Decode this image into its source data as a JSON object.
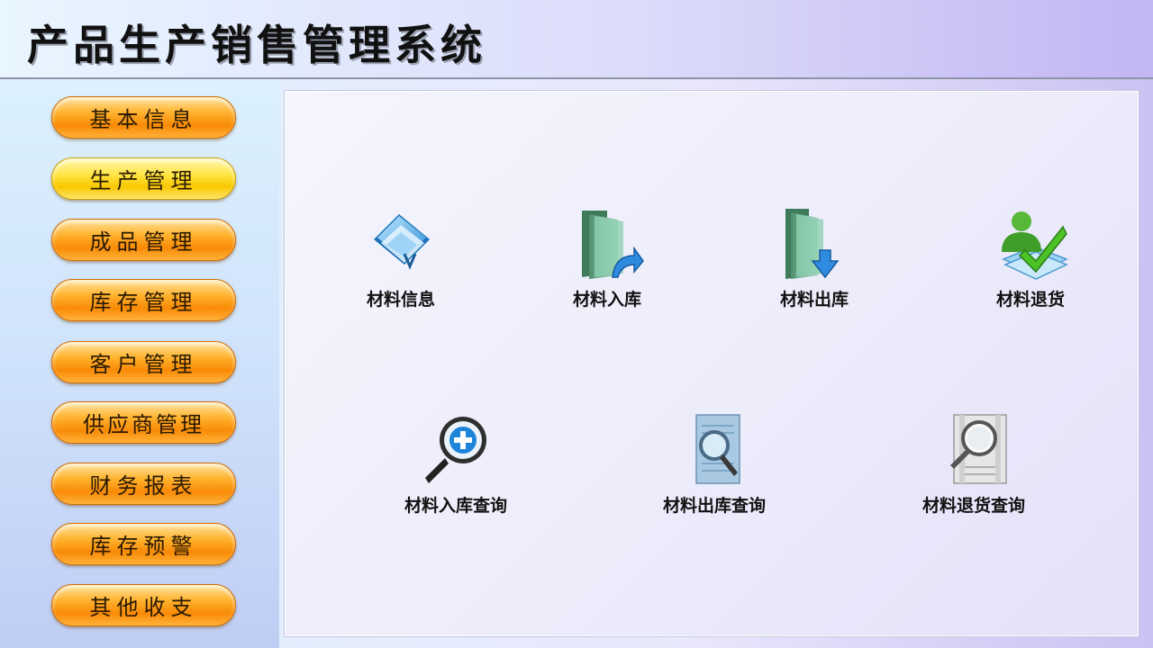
{
  "app": {
    "title": "产品生产销售管理系统"
  },
  "nav": [
    {
      "id": "basic-info",
      "label": "基本信息",
      "active": false
    },
    {
      "id": "production",
      "label": "生产管理",
      "active": true
    },
    {
      "id": "finished-goods",
      "label": "成品管理",
      "active": false
    },
    {
      "id": "inventory",
      "label": "库存管理",
      "active": false
    },
    {
      "id": "customer",
      "label": "客户管理",
      "active": false
    },
    {
      "id": "supplier",
      "label": "供应商管理",
      "active": false
    },
    {
      "id": "finance-report",
      "label": "财务报表",
      "active": false
    },
    {
      "id": "stock-warning",
      "label": "库存预警",
      "active": false
    },
    {
      "id": "other-income-expense",
      "label": "其他收支",
      "active": false
    }
  ],
  "functions": [
    {
      "id": "material-info",
      "label": "材料信息",
      "icon": "documents-icon"
    },
    {
      "id": "material-inbound",
      "label": "材料入库",
      "icon": "folder-in-icon"
    },
    {
      "id": "material-outbound",
      "label": "材料出库",
      "icon": "folder-out-icon"
    },
    {
      "id": "material-return",
      "label": "材料退货",
      "icon": "user-check-icon"
    },
    {
      "id": "material-inbound-query",
      "label": "材料入库查询",
      "icon": "magnifier-plus-icon"
    },
    {
      "id": "material-outbound-query",
      "label": "材料出库查询",
      "icon": "document-search-icon"
    },
    {
      "id": "material-return-query",
      "label": "材料退货查询",
      "icon": "film-search-icon"
    }
  ],
  "colors": {
    "nav_normal": "#f98a06",
    "nav_active": "#f9c800",
    "accent_blue": "#2c7fd6",
    "accent_green": "#3aa82a"
  }
}
